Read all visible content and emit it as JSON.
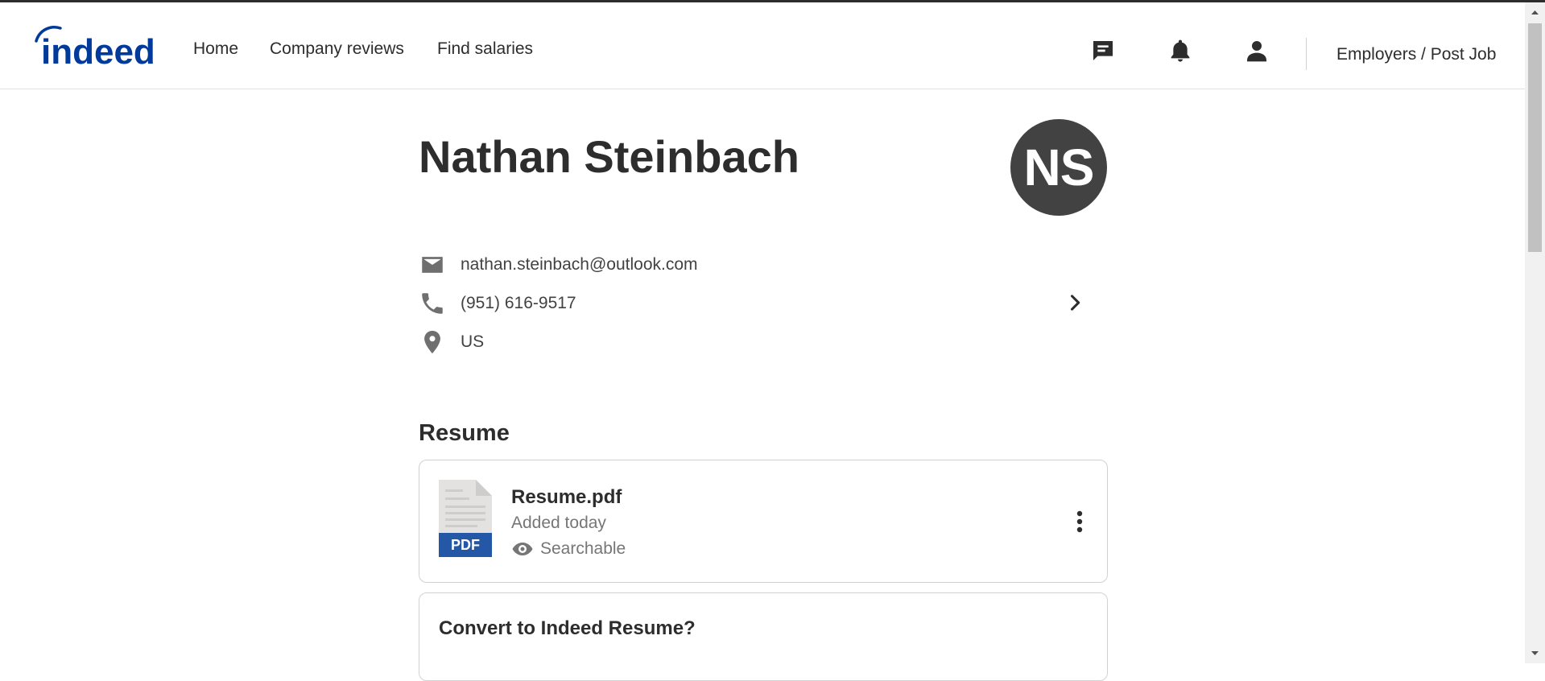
{
  "header": {
    "logo_text": "indeed",
    "nav": [
      {
        "label": "Home"
      },
      {
        "label": "Company reviews"
      },
      {
        "label": "Find salaries"
      }
    ],
    "icons": [
      "messages-icon",
      "notifications-bell-icon",
      "account-person-icon"
    ],
    "employers_label": "Employers / Post Job"
  },
  "profile": {
    "name": "Nathan Steinbach",
    "initials": "NS",
    "email": "nathan.steinbach@outlook.com",
    "phone": "(951) 616-9517",
    "location": "US"
  },
  "resume": {
    "section_title": "Resume",
    "file_name": "Resume.pdf",
    "file_type": "PDF",
    "added": "Added today",
    "visibility": "Searchable"
  },
  "convert": {
    "title": "Convert to Indeed Resume?"
  },
  "colors": {
    "brand_blue": "#2557a7",
    "logo_blue": "#003a9b",
    "text_dark": "#2d2d2d",
    "text_muted": "#767676",
    "avatar_bg": "#424242"
  }
}
